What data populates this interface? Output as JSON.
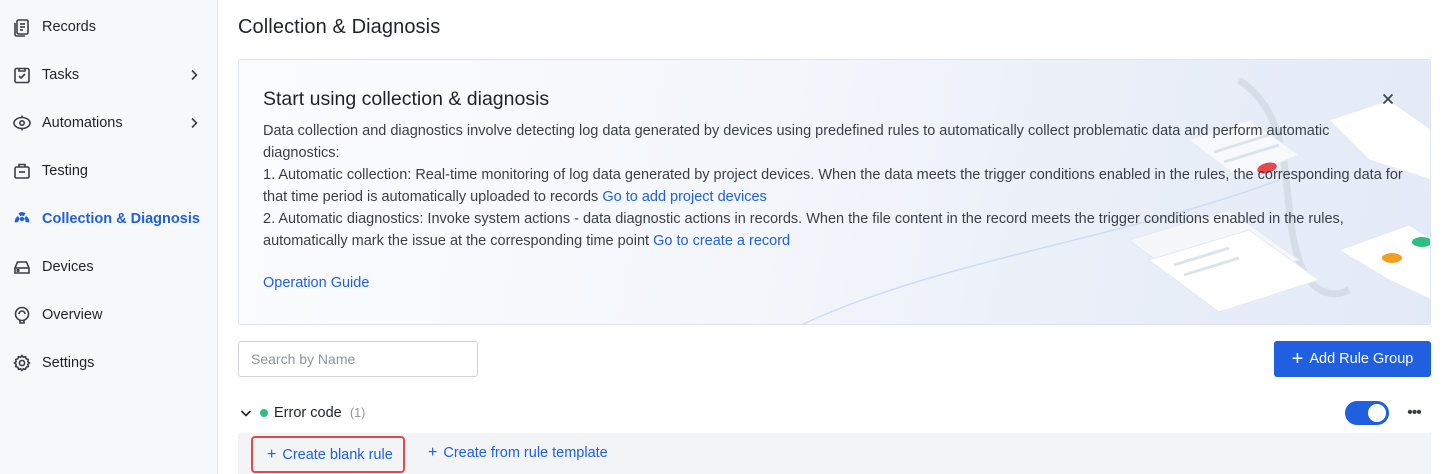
{
  "sidebar": {
    "items": [
      {
        "label": "Records",
        "icon": "records-icon",
        "active": false,
        "has_chevron": false
      },
      {
        "label": "Tasks",
        "icon": "tasks-icon",
        "active": false,
        "has_chevron": true
      },
      {
        "label": "Automations",
        "icon": "automations-icon",
        "active": false,
        "has_chevron": true
      },
      {
        "label": "Testing",
        "icon": "testing-icon",
        "active": false,
        "has_chevron": false
      },
      {
        "label": "Collection & Diagnosis",
        "icon": "collection-diagnosis-icon",
        "active": true,
        "has_chevron": false
      },
      {
        "label": "Devices",
        "icon": "devices-icon",
        "active": false,
        "has_chevron": false
      },
      {
        "label": "Overview",
        "icon": "overview-icon",
        "active": false,
        "has_chevron": false
      },
      {
        "label": "Settings",
        "icon": "settings-icon",
        "active": false,
        "has_chevron": false
      }
    ]
  },
  "page": {
    "title": "Collection & Diagnosis"
  },
  "banner": {
    "title": "Start using collection & diagnosis",
    "intro": "Data collection and diagnostics involve detecting log data generated by devices using predefined rules to automatically collect problematic data and perform automatic diagnostics:",
    "item1_text": "1. Automatic collection: Real-time monitoring of log data generated by project devices. When the data meets the trigger conditions enabled in the rules, the corresponding data for that time period is automatically uploaded to records",
    "item1_link": "Go to add project devices",
    "item2_text": "2. Automatic diagnostics: Invoke system actions - data diagnostic actions in records. When the file content in the record meets the trigger conditions enabled in the rules, automatically mark the issue at the corresponding time point",
    "item2_link": "Go to create a record",
    "guide_link": "Operation Guide"
  },
  "search": {
    "placeholder": "Search by Name",
    "value": ""
  },
  "toolbar": {
    "add_rule_group_label": "Add Rule Group"
  },
  "rule_group": {
    "name": "Error code",
    "count": "(1)",
    "enabled": true,
    "status_color": "#2ebd85"
  },
  "rule_actions": {
    "create_blank_label": "Create blank rule",
    "create_template_label": "Create from rule template"
  },
  "colors": {
    "accent": "#1f5fe0",
    "highlight_border": "#e5484d"
  }
}
